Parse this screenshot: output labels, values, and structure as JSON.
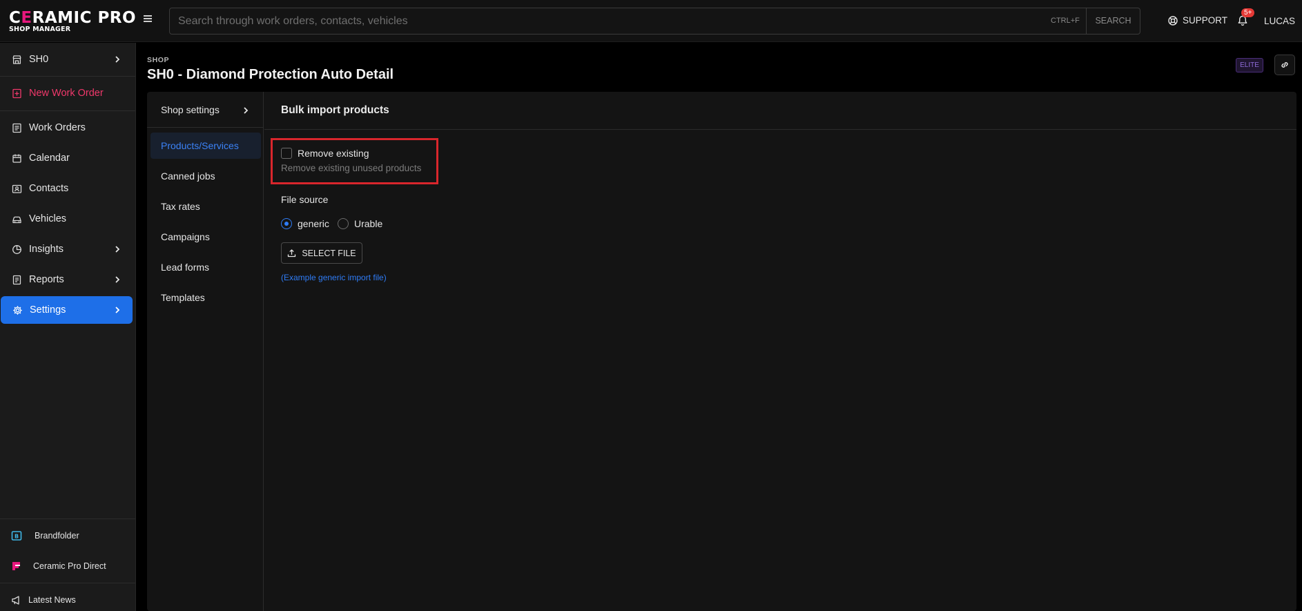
{
  "header": {
    "logo_main_pre": "C",
    "logo_main_e": "E",
    "logo_main_post": "RAMIC PRO",
    "logo_sub": "SHOP MANAGER",
    "search_placeholder": "Search through work orders, contacts, vehicles",
    "search_shortcut": "CTRL+F",
    "search_button": "SEARCH",
    "support_label": "SUPPORT",
    "notification_count": "5+",
    "user_label": "LUCAS"
  },
  "sidebar": {
    "shop": "SH0",
    "new_work_order": "New Work Order",
    "items": [
      {
        "label": "Work Orders"
      },
      {
        "label": "Calendar"
      },
      {
        "label": "Contacts"
      },
      {
        "label": "Vehicles"
      },
      {
        "label": "Insights"
      },
      {
        "label": "Reports"
      },
      {
        "label": "Settings"
      }
    ],
    "bottom": [
      {
        "label": "Brandfolder"
      },
      {
        "label": "Ceramic Pro Direct"
      },
      {
        "label": "Latest News"
      }
    ]
  },
  "page": {
    "breadcrumb": "SHOP",
    "title": "SH0 - Diamond Protection Auto Detail",
    "tier_badge": "ELITE"
  },
  "subnav": {
    "header": "Shop settings",
    "items": [
      {
        "label": "Products/Services"
      },
      {
        "label": "Canned jobs"
      },
      {
        "label": "Tax rates"
      },
      {
        "label": "Campaigns"
      },
      {
        "label": "Lead forms"
      },
      {
        "label": "Templates"
      }
    ]
  },
  "form": {
    "title": "Bulk import products",
    "remove_existing_label": "Remove existing",
    "remove_existing_help": "Remove existing unused products",
    "remove_existing_checked": false,
    "file_source_label": "File source",
    "file_source_options": [
      "generic",
      "Urable"
    ],
    "file_source_selected": "generic",
    "select_file_button": "SELECT FILE",
    "example_link": "(Example generic import file)"
  },
  "colors": {
    "accent": "#1e6fe8",
    "new_work_order": "#f0386b",
    "highlight_border": "#d9262c",
    "badge": "#e53935"
  }
}
